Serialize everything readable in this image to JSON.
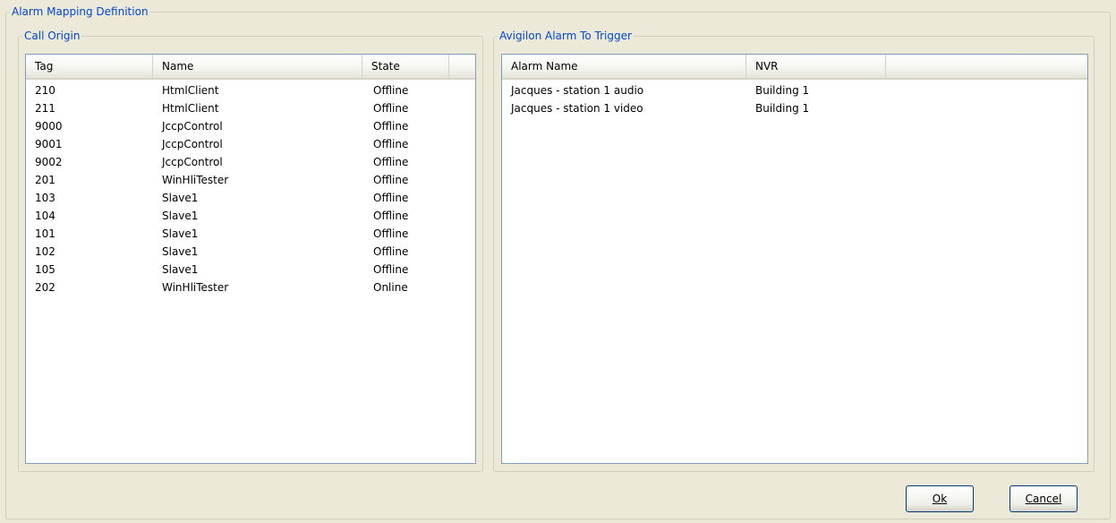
{
  "outer_group": {
    "legend": "Alarm Mapping Definition"
  },
  "call_origin": {
    "legend": "Call Origin",
    "columns": [
      "Tag",
      "Name",
      "State"
    ],
    "rows": [
      {
        "tag": "210",
        "name": "HtmlClient",
        "state": "Offline"
      },
      {
        "tag": "211",
        "name": "HtmlClient",
        "state": "Offline"
      },
      {
        "tag": "9000",
        "name": "JccpControl",
        "state": "Offline"
      },
      {
        "tag": "9001",
        "name": "JccpControl",
        "state": "Offline"
      },
      {
        "tag": "9002",
        "name": "JccpControl",
        "state": "Offline"
      },
      {
        "tag": "201",
        "name": "WinHliTester",
        "state": "Offline"
      },
      {
        "tag": "103",
        "name": "Slave1",
        "state": "Offline"
      },
      {
        "tag": "104",
        "name": "Slave1",
        "state": "Offline"
      },
      {
        "tag": "101",
        "name": "Slave1",
        "state": "Offline"
      },
      {
        "tag": "102",
        "name": "Slave1",
        "state": "Offline"
      },
      {
        "tag": "105",
        "name": "Slave1",
        "state": "Offline"
      },
      {
        "tag": "202",
        "name": "WinHliTester",
        "state": "Online"
      }
    ]
  },
  "alarm_trigger": {
    "legend": "Avigilon Alarm To Trigger",
    "columns": [
      "Alarm Name",
      "NVR"
    ],
    "rows": [
      {
        "alarm_name": "Jacques - station 1 audio",
        "nvr": "Building 1"
      },
      {
        "alarm_name": "Jacques - station 1 video",
        "nvr": "Building 1"
      }
    ]
  },
  "buttons": {
    "ok_label": "Ok",
    "cancel_label": "Cancel"
  },
  "colors": {
    "legend_text": "#0046d5",
    "dialog_bg": "#ece9d8",
    "list_border": "#7f9db9"
  }
}
